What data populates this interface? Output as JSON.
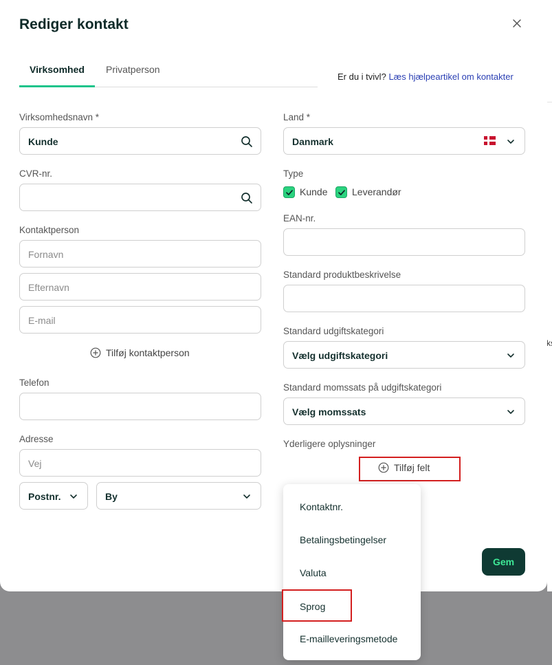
{
  "modal": {
    "title": "Rediger kontakt"
  },
  "tabs": [
    {
      "label": "Virksomhed"
    },
    {
      "label": "Privatperson"
    }
  ],
  "help": {
    "prefix": "Er du i tvivl?",
    "link": "Læs hjælpeartikel om kontakter"
  },
  "left": {
    "company_label": "Virksomhedsnavn *",
    "company_value": "Kunde",
    "cvr_label": "CVR-nr.",
    "cvr_value": "",
    "contact_label": "Kontaktperson",
    "first_name_placeholder": "Fornavn",
    "last_name_placeholder": "Efternavn",
    "email_placeholder": "E-mail",
    "add_contact": "Tilføj kontaktperson",
    "phone_label": "Telefon",
    "address_label": "Adresse",
    "street_placeholder": "Vej",
    "postal_select": "Postnr.",
    "city_select": "By"
  },
  "right": {
    "country_label": "Land *",
    "country_value": "Danmark",
    "type_label": "Type",
    "type_customer": "Kunde",
    "type_supplier": "Leverandør",
    "ean_label": "EAN-nr.",
    "product_desc_label": "Standard produktbeskrivelse",
    "expense_cat_label": "Standard udgiftskategori",
    "expense_cat_value": "Vælg udgiftskategori",
    "vat_label": "Standard momssats på udgiftskategori",
    "vat_value": "Vælg momssats",
    "extra_label": "Yderligere oplysninger",
    "add_field": "Tilføj felt"
  },
  "dropdown": {
    "items": [
      {
        "label": "Kontaktnr."
      },
      {
        "label": "Betalingsbetingelser"
      },
      {
        "label": "Valuta"
      },
      {
        "label": "Sprog"
      },
      {
        "label": "E-mailleveringsmetode"
      }
    ]
  },
  "save_button": "Gem",
  "background": {
    "peek_text": "ks"
  },
  "colors": {
    "accent": "#1ec48b",
    "checkbox": "#2bd37f",
    "save_bg": "#0f3a33",
    "save_text": "#3ee896",
    "link": "#2a3fb3",
    "highlight": "#d31f1f"
  }
}
